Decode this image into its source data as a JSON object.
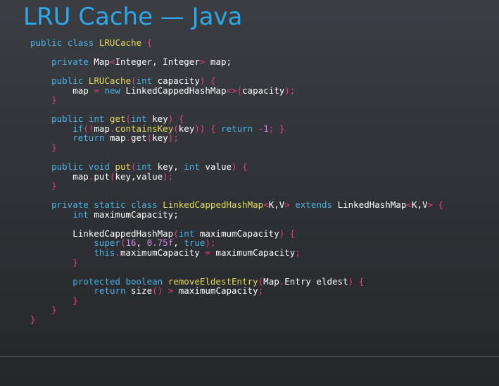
{
  "slide": {
    "title": "LRU Cache — Java"
  },
  "code": {
    "language": "Java",
    "lines": [
      [
        [
          "kw",
          "public"
        ],
        [
          "tx",
          " "
        ],
        [
          "kw",
          "class"
        ],
        [
          "tx",
          " "
        ],
        [
          "cls",
          "LRUCache"
        ],
        [
          "tx",
          " "
        ],
        [
          "pn",
          "{"
        ]
      ],
      [],
      [
        [
          "tx",
          "    "
        ],
        [
          "kw",
          "private"
        ],
        [
          "tx",
          " Map"
        ],
        [
          "pn",
          "<"
        ],
        [
          "tx",
          "Integer, Integer"
        ],
        [
          "pn",
          ">"
        ],
        [
          "tx",
          " map;"
        ]
      ],
      [],
      [
        [
          "tx",
          "    "
        ],
        [
          "kw",
          "public"
        ],
        [
          "tx",
          " "
        ],
        [
          "fn",
          "LRUCache"
        ],
        [
          "pn",
          "("
        ],
        [
          "kw",
          "int"
        ],
        [
          "tx",
          " capacity"
        ],
        [
          "pn",
          ")"
        ],
        [
          "tx",
          " "
        ],
        [
          "pn",
          "{"
        ]
      ],
      [
        [
          "tx",
          "        map "
        ],
        [
          "pn",
          "="
        ],
        [
          "tx",
          " "
        ],
        [
          "kw",
          "new"
        ],
        [
          "tx",
          " LinkedCappedHashMap"
        ],
        [
          "pn",
          "<>"
        ],
        [
          "pn",
          "("
        ],
        [
          "tx",
          "capacity"
        ],
        [
          "pn",
          ")"
        ],
        [
          "pn",
          ";"
        ]
      ],
      [
        [
          "tx",
          "    "
        ],
        [
          "pn",
          "}"
        ]
      ],
      [],
      [
        [
          "tx",
          "    "
        ],
        [
          "kw",
          "public"
        ],
        [
          "tx",
          " "
        ],
        [
          "kw",
          "int"
        ],
        [
          "tx",
          " "
        ],
        [
          "fn",
          "get"
        ],
        [
          "pn",
          "("
        ],
        [
          "kw",
          "int"
        ],
        [
          "tx",
          " key"
        ],
        [
          "pn",
          ")"
        ],
        [
          "tx",
          " "
        ],
        [
          "pn",
          "{"
        ]
      ],
      [
        [
          "tx",
          "        "
        ],
        [
          "kw",
          "if"
        ],
        [
          "pn",
          "(!"
        ],
        [
          "tx",
          "map"
        ],
        [
          "pn",
          "."
        ],
        [
          "fn",
          "containsKey"
        ],
        [
          "pn",
          "("
        ],
        [
          "tx",
          "key"
        ],
        [
          "pn",
          "))"
        ],
        [
          "tx",
          " "
        ],
        [
          "pn",
          "{"
        ],
        [
          "tx",
          " "
        ],
        [
          "kw",
          "return"
        ],
        [
          "tx",
          " "
        ],
        [
          "pn",
          "-"
        ],
        [
          "num",
          "1"
        ],
        [
          "pn",
          ";"
        ],
        [
          "tx",
          " "
        ],
        [
          "pn",
          "}"
        ]
      ],
      [
        [
          "tx",
          "        "
        ],
        [
          "kw",
          "return"
        ],
        [
          "tx",
          " map"
        ],
        [
          "pn",
          "."
        ],
        [
          "tx",
          "get"
        ],
        [
          "pn",
          "("
        ],
        [
          "tx",
          "key"
        ],
        [
          "pn",
          ")"
        ],
        [
          "pn",
          ";"
        ]
      ],
      [
        [
          "tx",
          "    "
        ],
        [
          "pn",
          "}"
        ]
      ],
      [],
      [
        [
          "tx",
          "    "
        ],
        [
          "kw",
          "public"
        ],
        [
          "tx",
          " "
        ],
        [
          "kw",
          "void"
        ],
        [
          "tx",
          " "
        ],
        [
          "fn",
          "put"
        ],
        [
          "pn",
          "("
        ],
        [
          "kw",
          "int"
        ],
        [
          "tx",
          " key, "
        ],
        [
          "kw",
          "int"
        ],
        [
          "tx",
          " value"
        ],
        [
          "pn",
          ")"
        ],
        [
          "tx",
          " "
        ],
        [
          "pn",
          "{"
        ]
      ],
      [
        [
          "tx",
          "        map"
        ],
        [
          "pn",
          "."
        ],
        [
          "tx",
          "put"
        ],
        [
          "pn",
          "("
        ],
        [
          "tx",
          "key,value"
        ],
        [
          "pn",
          ")"
        ],
        [
          "pn",
          ";"
        ]
      ],
      [
        [
          "tx",
          "    "
        ],
        [
          "pn",
          "}"
        ]
      ],
      [],
      [
        [
          "tx",
          "    "
        ],
        [
          "kw",
          "private"
        ],
        [
          "tx",
          " "
        ],
        [
          "kw",
          "static"
        ],
        [
          "tx",
          " "
        ],
        [
          "kw",
          "class"
        ],
        [
          "tx",
          " "
        ],
        [
          "cls",
          "LinkedCappedHashMap"
        ],
        [
          "pn",
          "<"
        ],
        [
          "tx",
          "K,V"
        ],
        [
          "pn",
          ">"
        ],
        [
          "tx",
          " "
        ],
        [
          "kw",
          "extends"
        ],
        [
          "tx",
          " LinkedHashMap"
        ],
        [
          "pn",
          "<"
        ],
        [
          "tx",
          "K,V"
        ],
        [
          "pn",
          ">"
        ],
        [
          "tx",
          " "
        ],
        [
          "pn",
          "{"
        ]
      ],
      [
        [
          "tx",
          "        "
        ],
        [
          "kw",
          "int"
        ],
        [
          "tx",
          " maximumCapacity;"
        ]
      ],
      [],
      [
        [
          "tx",
          "        LinkedCappedHashMap"
        ],
        [
          "pn",
          "("
        ],
        [
          "kw",
          "int"
        ],
        [
          "tx",
          " maximumCapacity"
        ],
        [
          "pn",
          ")"
        ],
        [
          "tx",
          " "
        ],
        [
          "pn",
          "{"
        ]
      ],
      [
        [
          "tx",
          "            "
        ],
        [
          "kw",
          "super"
        ],
        [
          "pn",
          "("
        ],
        [
          "num",
          "16"
        ],
        [
          "tx",
          ", "
        ],
        [
          "num",
          "0.75f"
        ],
        [
          "tx",
          ", "
        ],
        [
          "kw",
          "true"
        ],
        [
          "pn",
          ")"
        ],
        [
          "pn",
          ";"
        ]
      ],
      [
        [
          "tx",
          "            "
        ],
        [
          "kw",
          "this"
        ],
        [
          "pn",
          "."
        ],
        [
          "tx",
          "maximumCapacity "
        ],
        [
          "pn",
          "="
        ],
        [
          "tx",
          " maximumCapacity"
        ],
        [
          "pn",
          ";"
        ]
      ],
      [
        [
          "tx",
          "        "
        ],
        [
          "pn",
          "}"
        ]
      ],
      [],
      [
        [
          "tx",
          "        "
        ],
        [
          "kw",
          "protected"
        ],
        [
          "tx",
          " "
        ],
        [
          "kw",
          "boolean"
        ],
        [
          "tx",
          " "
        ],
        [
          "fn",
          "removeEldestEntry"
        ],
        [
          "pn",
          "("
        ],
        [
          "tx",
          "Map"
        ],
        [
          "pn",
          "."
        ],
        [
          "tx",
          "Entry eldest"
        ],
        [
          "pn",
          ")"
        ],
        [
          "tx",
          " "
        ],
        [
          "pn",
          "{"
        ]
      ],
      [
        [
          "tx",
          "            "
        ],
        [
          "kw",
          "return"
        ],
        [
          "tx",
          " size"
        ],
        [
          "pn",
          "()"
        ],
        [
          "tx",
          " "
        ],
        [
          "pn",
          ">"
        ],
        [
          "tx",
          " maximumCapacity"
        ],
        [
          "pn",
          ";"
        ]
      ],
      [
        [
          "tx",
          "        "
        ],
        [
          "pn",
          "}"
        ]
      ],
      [
        [
          "tx",
          "    "
        ],
        [
          "pn",
          "}"
        ]
      ],
      [
        [
          "pn",
          "}"
        ]
      ]
    ]
  },
  "colors": {
    "title": "#2ea8e6",
    "keyword": "#4bb3e6",
    "class_name": "#e6db5b",
    "punctuation": "#ee3f7d",
    "number": "#d48ae8",
    "text": "#ffffff",
    "background_top": "#3a3e43",
    "background_bottom": "#25272a"
  }
}
